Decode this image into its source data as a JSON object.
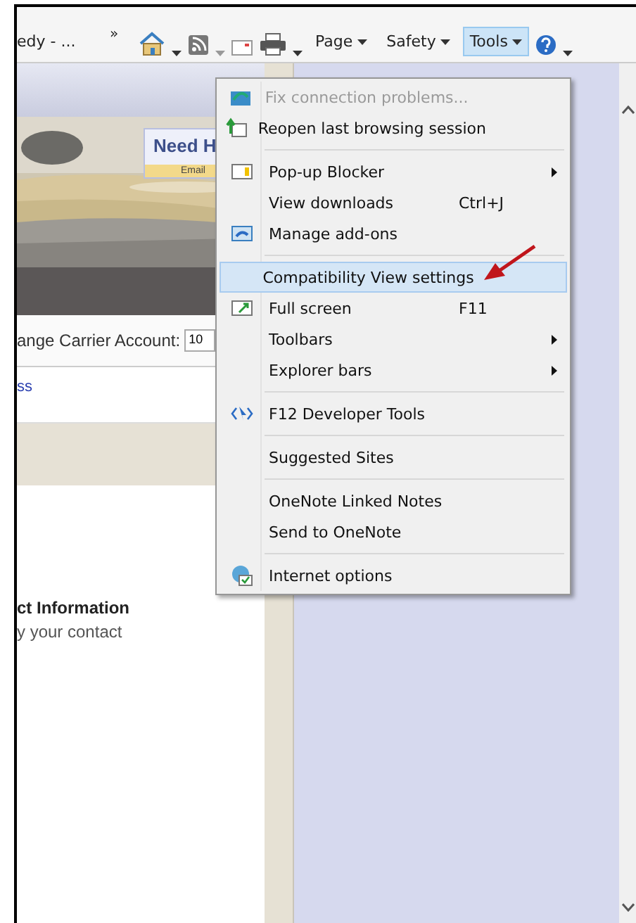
{
  "toolbar": {
    "tab_title": "edy - ...",
    "overflow": "»",
    "commands": [
      {
        "label": "Page",
        "selected": false
      },
      {
        "label": "Safety",
        "selected": false
      },
      {
        "label": "Tools",
        "selected": true
      }
    ]
  },
  "webpage": {
    "banner_title": "Need H",
    "banner_link": "Email",
    "carrier_label": "ange Carrier Account:",
    "carrier_value": "10",
    "link": "ss",
    "section_title": "ct Information",
    "section_text": "y your contact"
  },
  "menu": {
    "groups": [
      [
        {
          "label": "Fix connection problems...",
          "disabled": true,
          "selected": false
        },
        {
          "label": "Reopen last browsing session",
          "disabled": false,
          "selected": false
        }
      ],
      [
        {
          "label": "Pop-up Blocker",
          "submenu": true,
          "disabled": false,
          "selected": false
        },
        {
          "label": "View downloads",
          "shortcut": "Ctrl+J",
          "disabled": false,
          "selected": false
        },
        {
          "label": "Manage add-ons",
          "disabled": false,
          "selected": false
        }
      ],
      [
        {
          "label": "Compatibility View settings",
          "disabled": false,
          "selected": true
        },
        {
          "label": "Full screen",
          "shortcut": "F11",
          "disabled": false,
          "selected": false
        },
        {
          "label": "Toolbars",
          "submenu": true,
          "disabled": false,
          "selected": false
        },
        {
          "label": "Explorer bars",
          "submenu": true,
          "disabled": false,
          "selected": false
        }
      ],
      [
        {
          "label": "F12 Developer Tools",
          "disabled": false,
          "selected": false
        }
      ],
      [
        {
          "label": "Suggested Sites",
          "disabled": false,
          "selected": false
        }
      ],
      [
        {
          "label": "OneNote Linked Notes",
          "disabled": false,
          "selected": false
        },
        {
          "label": "Send to OneNote",
          "disabled": false,
          "selected": false
        }
      ],
      [
        {
          "label": "Internet options",
          "disabled": false,
          "selected": false
        }
      ]
    ]
  }
}
